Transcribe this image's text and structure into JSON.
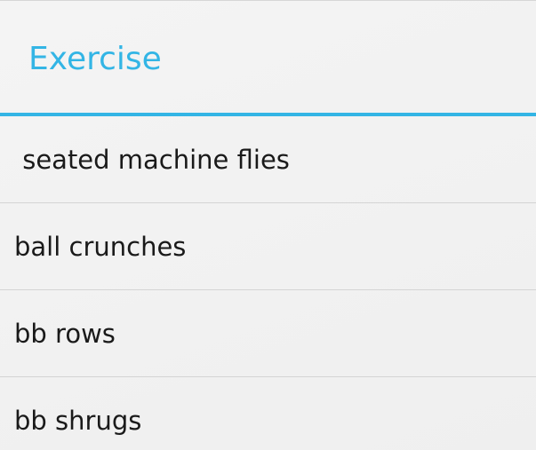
{
  "dialog": {
    "title": "Exercise",
    "accent_color": "#33b5e5"
  },
  "exercises": [
    {
      "label": " seated machine flies"
    },
    {
      "label": "ball crunches"
    },
    {
      "label": "bb rows"
    },
    {
      "label": "bb shrugs"
    }
  ]
}
